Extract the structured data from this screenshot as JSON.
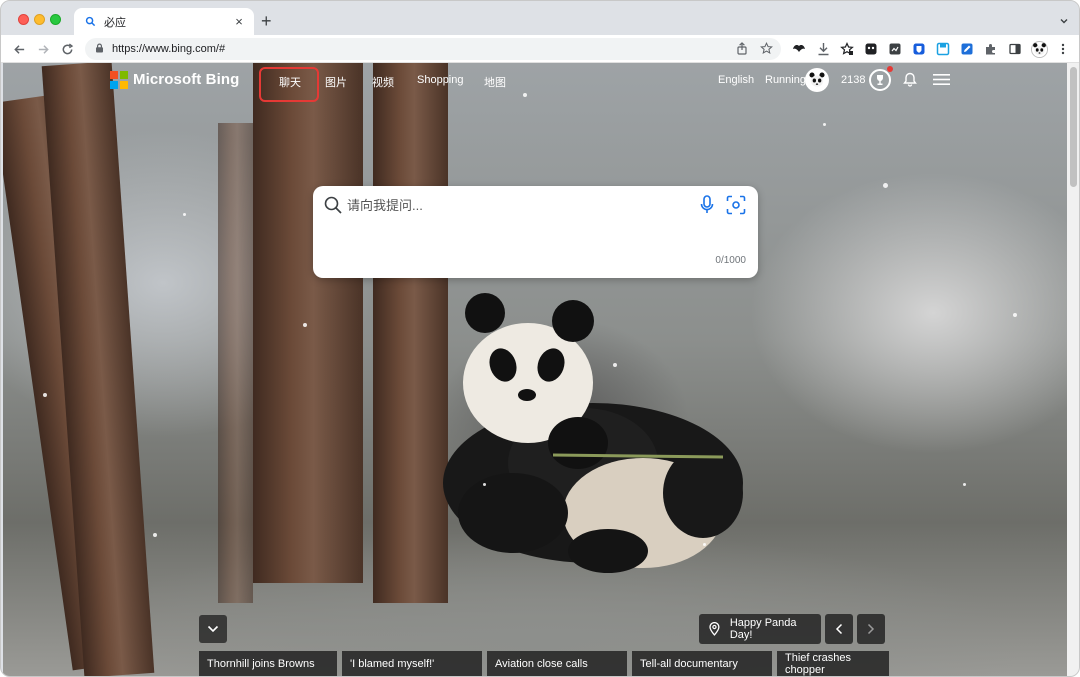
{
  "browser": {
    "tab_title": "必应",
    "new_tab_symbol": "+",
    "tab_close_symbol": "×",
    "url": "https://www.bing.com/#"
  },
  "bing": {
    "brand": "Microsoft Bing",
    "nav": [
      "聊天",
      "图片",
      "视频",
      "Shopping",
      "地图"
    ],
    "language": "English",
    "user_name": "Running",
    "points": "2138"
  },
  "search": {
    "placeholder": "请向我提问...",
    "counter": "0/1000"
  },
  "bottom": {
    "featured": "Happy Panda Day!",
    "news": [
      "Thornhill joins Browns",
      "'I blamed myself!'",
      "Aviation close calls",
      "Tell-all documentary",
      "Thief crashes chopper"
    ]
  },
  "colors": {
    "highlight": "#e53935",
    "ms_red": "#f25022",
    "ms_green": "#7fba00",
    "ms_blue": "#00a4ef",
    "ms_yellow": "#ffb900"
  }
}
